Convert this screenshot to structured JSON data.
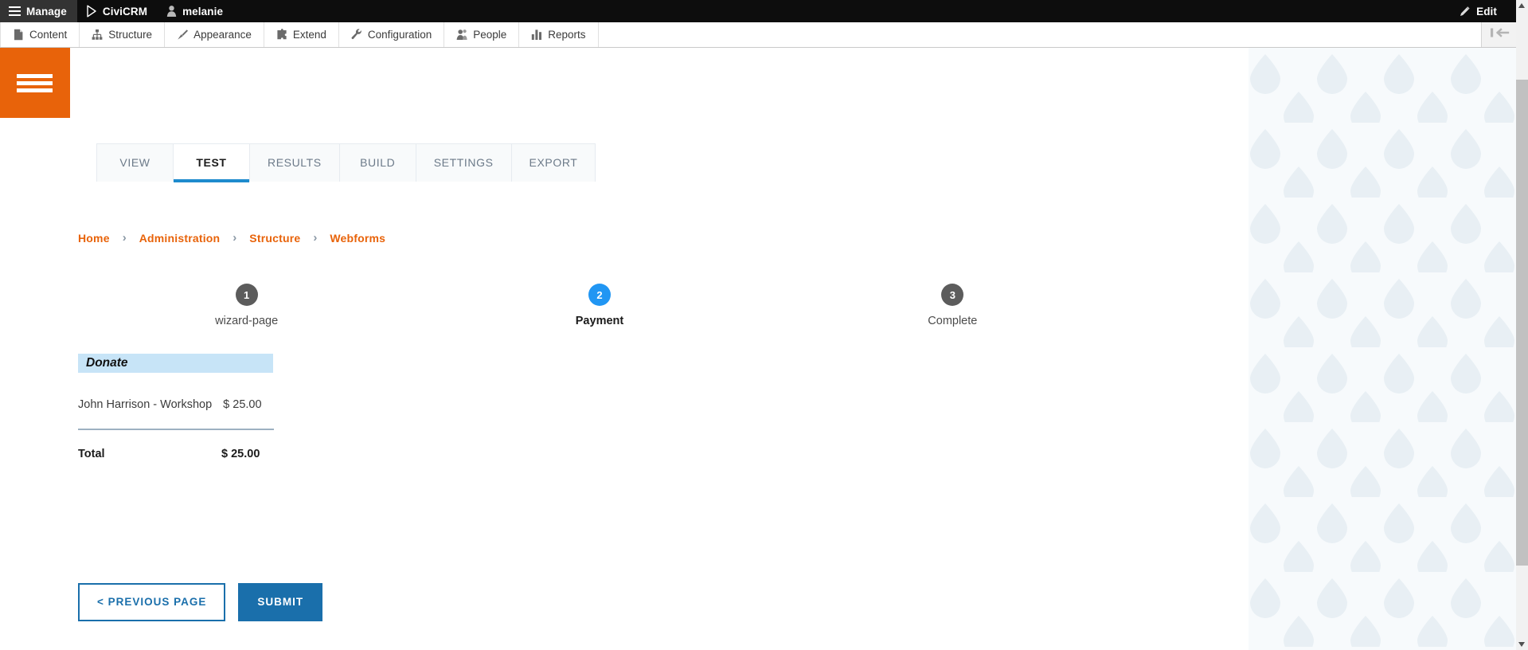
{
  "toolbar": {
    "items": [
      {
        "label": "Manage",
        "icon": "hamburger-icon",
        "active": true
      },
      {
        "label": "CiviCRM",
        "icon": "civicrm-triangle-icon",
        "active": false
      },
      {
        "label": "melanie",
        "icon": "user-account-icon",
        "active": false
      }
    ],
    "edit": {
      "label": "Edit",
      "icon": "pencil-icon"
    }
  },
  "admin_menu": {
    "items": [
      {
        "label": "Content",
        "icon": "document-icon"
      },
      {
        "label": "Structure",
        "icon": "sitemap-icon"
      },
      {
        "label": "Appearance",
        "icon": "paintbrush-icon"
      },
      {
        "label": "Extend",
        "icon": "puzzle-piece-icon"
      },
      {
        "label": "Configuration",
        "icon": "wrench-icon"
      },
      {
        "label": "People",
        "icon": "people-icon"
      },
      {
        "label": "Reports",
        "icon": "bar-chart-icon"
      }
    ],
    "collapse": {
      "icon": "collapse-left-icon"
    }
  },
  "sidebar_toggle": {
    "icon": "hamburger-icon"
  },
  "tabs": [
    {
      "label": "VIEW",
      "active": false
    },
    {
      "label": "TEST",
      "active": true
    },
    {
      "label": "RESULTS",
      "active": false
    },
    {
      "label": "BUILD",
      "active": false
    },
    {
      "label": "SETTINGS",
      "active": false
    },
    {
      "label": "EXPORT",
      "active": false
    }
  ],
  "breadcrumb": {
    "separator": "›",
    "items": [
      {
        "label": "Home"
      },
      {
        "label": "Administration"
      },
      {
        "label": "Structure"
      },
      {
        "label": "Webforms"
      }
    ]
  },
  "wizard": {
    "steps": [
      {
        "number": "1",
        "label": "wizard-page",
        "state": "incomplete"
      },
      {
        "number": "2",
        "label": "Payment",
        "state": "current"
      },
      {
        "number": "3",
        "label": "Complete",
        "state": "incomplete"
      }
    ]
  },
  "payment": {
    "section_title": "Donate",
    "line_items": [
      {
        "name": "John Harrison - Workshop",
        "amount": "$ 25.00"
      }
    ],
    "total_label": "Total",
    "total_amount": "$ 25.00"
  },
  "actions": {
    "previous": "< PREVIOUS PAGE",
    "submit": "SUBMIT"
  },
  "colors": {
    "toolbar_bg": "#0d0d0d",
    "toolbar_active_bg": "#333333",
    "brand_orange": "#e8630a",
    "accent_blue": "#1e8bcd",
    "step_active_blue": "#2196f3",
    "step_inactive_gray": "#5c5c5c",
    "button_blue": "#1a6fab",
    "band_blue": "#c7e4f7",
    "rule_gray": "#9db1c1"
  }
}
